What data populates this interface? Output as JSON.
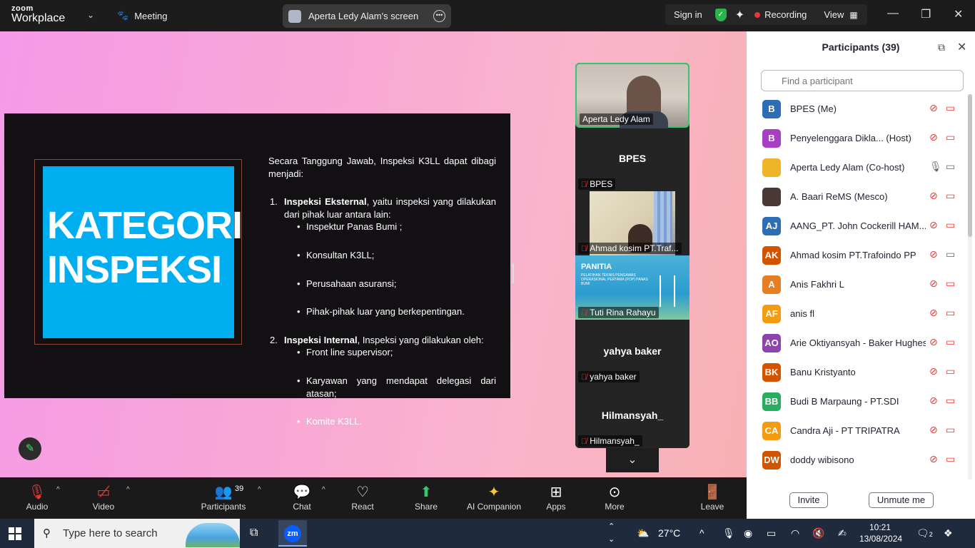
{
  "app": {
    "logo_line1": "zoom",
    "logo_line2": "Workplace",
    "meeting_label": "Meeting",
    "screen_share_label": "Aperta Ledy Alam's screen",
    "sign_in": "Sign in",
    "recording": "Recording",
    "view": "View"
  },
  "slide": {
    "title_line1": "KATEGORI",
    "title_line2": "INSPEKSI",
    "intro": "Secara Tanggung Jawab, Inspeksi K3LL dapat dibagi menjadi:",
    "items": [
      {
        "num": "1.",
        "head": "Inspeksi Eksternal",
        "rest": ", yaitu inspeksi yang dilakukan dari pihak luar antara lain:",
        "bullets": [
          "Inspektur Panas Bumi ;",
          "Konsultan K3LL;",
          "Perusahaan asuransi;",
          "Pihak-pihak luar yang berkepentingan."
        ]
      },
      {
        "num": "2.",
        "head": "Inspeksi Internal",
        "rest": ", Inspeksi yang dilakukan oleh:",
        "bullets": [
          "Front line supervisor;",
          "Karyawan yang mendapat delegasi dari atasan;",
          "Komite K3LL."
        ]
      }
    ]
  },
  "video_tiles": {
    "t1_name": "Aperta Ledy Alam",
    "t2_big": "BPES",
    "t2_name": "BPES",
    "t3_name": "Ahmad kosim PT.Traf...",
    "t4_title": "PANITIA",
    "t4_sub": "PELATIHAN TEKNIS PENGAWAS OPERASIONAL PERTAMA (POP) PANAS BUMI",
    "t4_name": "Tuti Rina Rahayu",
    "t5_big": "yahya baker",
    "t5_name": "yahya baker",
    "t6_big": "Hilmansyah_",
    "t6_name": "Hilmansyah_"
  },
  "participants": {
    "title": "Participants (39)",
    "search_placeholder": "Find a participant",
    "invite": "Invite",
    "unmute_me": "Unmute me",
    "rows": [
      {
        "initials": "B",
        "color": "#2d6db5",
        "name": "BPES (Me)"
      },
      {
        "initials": "B",
        "color": "#a63fc4",
        "name": "Penyelenggara Dikla... (Host)"
      },
      {
        "initials": "",
        "color": "#f0b429",
        "name": "Aperta Ledy Alam (Co-host)"
      },
      {
        "initials": "",
        "color": "#4a3a36",
        "name": "A. Baari ReMS (Mesco)"
      },
      {
        "initials": "AJ",
        "color": "#2d6db5",
        "name": "AANG_PT. John Cockerill HAM..."
      },
      {
        "initials": "AK",
        "color": "#d35400",
        "name": "Ahmad kosim PT.Trafoindo PP"
      },
      {
        "initials": "A",
        "color": "#e67e22",
        "name": "Anis Fakhri L"
      },
      {
        "initials": "AF",
        "color": "#f39c12",
        "name": "anis fl"
      },
      {
        "initials": "AO",
        "color": "#8e44ad",
        "name": "Arie Oktiyansyah - Baker Hughes"
      },
      {
        "initials": "BK",
        "color": "#d35400",
        "name": "Banu Kristyanto"
      },
      {
        "initials": "BB",
        "color": "#27ae60",
        "name": "Budi B Marpaung - PT.SDI"
      },
      {
        "initials": "CA",
        "color": "#f39c12",
        "name": "Candra Aji - PT TRIPATRA"
      },
      {
        "initials": "DW",
        "color": "#d35400",
        "name": "doddy wibisono"
      }
    ]
  },
  "toolbar": {
    "audio": "Audio",
    "video": "Video",
    "participants": "Participants",
    "participants_count": "39",
    "chat": "Chat",
    "react": "React",
    "share": "Share",
    "ai_companion": "AI Companion",
    "apps": "Apps",
    "more": "More",
    "leave": "Leave"
  },
  "taskbar": {
    "search_placeholder": "Type here to search",
    "zoom_app": "zm",
    "temperature": "27°C",
    "time": "10:21",
    "date": "13/08/2024",
    "notifications": "2"
  }
}
